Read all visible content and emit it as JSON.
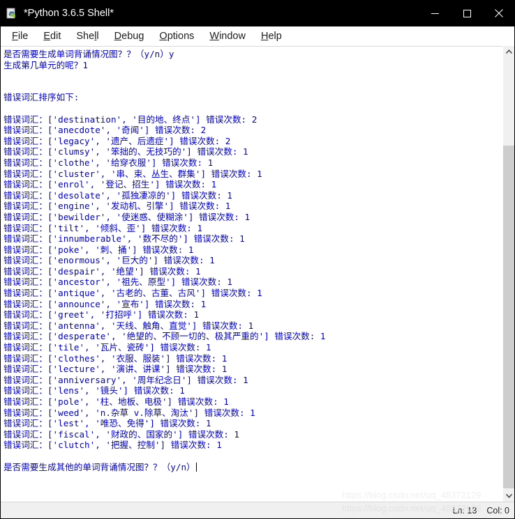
{
  "window": {
    "title": "*Python 3.6.5 Shell*",
    "icon": "python-idle-icon",
    "controls": {
      "minimize": "—",
      "maximize": "□",
      "close": "✕"
    },
    "colors": {
      "titlebar_bg": "#000000",
      "titlebar_fg": "#ffffff",
      "console_bg": "#ffffff",
      "console_fg": "#0000d0",
      "scrollbar_thumb": "#cdcdcd",
      "statusbar_bg": "#f0f0f0"
    }
  },
  "menubar": {
    "items": [
      {
        "label": "File",
        "mnemonic": "F"
      },
      {
        "label": "Edit",
        "mnemonic": "E"
      },
      {
        "label": "Shell",
        "mnemonic": "l"
      },
      {
        "label": "Debug",
        "mnemonic": "D"
      },
      {
        "label": "Options",
        "mnemonic": "O"
      },
      {
        "label": "Window",
        "mnemonic": "W"
      },
      {
        "label": "Help",
        "mnemonic": "H"
      }
    ]
  },
  "console": {
    "lines": [
      "是否需要生成单词背诵情况图？？（y/n）y",
      "生成第几单元的呢？1",
      "",
      "",
      "错误词汇排序如下:",
      "",
      "错误词汇：['destination', '目的地、终点'] 错误次数: 2",
      "错误词汇：['anecdote', '奇闻'] 错误次数: 2",
      "错误词汇：['legacy', '遗产、后遗症'] 错误次数: 2",
      "错误词汇：['clumsy', '笨拙的、无技巧的'] 错误次数: 1",
      "错误词汇：['clothe', '给穿衣服'] 错误次数: 1",
      "错误词汇：['cluster', '串、束、丛生、群集'] 错误次数: 1",
      "错误词汇：['enrol', '登记、招生'] 错误次数: 1",
      "错误词汇：['desolate', '孤独凄凉的'] 错误次数: 1",
      "错误词汇：['engine', '发动机、引擎'] 错误次数: 1",
      "错误词汇：['bewilder', '使迷惑、使糊涂'] 错误次数: 1",
      "错误词汇：['tilt', '倾斜、歪'] 错误次数: 1",
      "错误词汇：['innumberable', '数不尽的'] 错误次数: 1",
      "错误词汇：['poke', '刺、捅'] 错误次数: 1",
      "错误词汇：['enormous', '巨大的'] 错误次数: 1",
      "错误词汇：['despair', '绝望'] 错误次数: 1",
      "错误词汇：['ancestor', '祖先、原型'] 错误次数: 1",
      "错误词汇：['antique', '古老的、古董、古风'] 错误次数: 1",
      "错误词汇：['announce', '宣布'] 错误次数: 1",
      "错误词汇：['greet', '打招呼'] 错误次数: 1",
      "错误词汇：['antenna', '天线、触角、直觉'] 错误次数: 1",
      "错误词汇：['desperate', '绝望的、不顾一切的、极其严重的'] 错误次数: 1",
      "错误词汇：['tile', '瓦片、瓷砖'] 错误次数: 1",
      "错误词汇：['clothes', '衣服、服装'] 错误次数: 1",
      "错误词汇：['lecture', '演讲、讲课'] 错误次数: 1",
      "错误词汇：['anniversary', '周年纪念日'] 错误次数: 1",
      "错误词汇：['lens', '镜头'] 错误次数: 1",
      "错误词汇：['pole', '柱、地板、电极'] 错误次数: 1",
      "错误词汇：['weed', 'n.杂草 v.除草、淘汰'] 错误次数: 1",
      "错误词汇：['lest', '唯恐、免得'] 错误次数: 1",
      "错误词汇：['fiscal', '财政的、国家的'] 错误次数: 1",
      "错误词汇：['clutch', '把握、控制'] 错误次数: 1",
      "",
      "是否需要生成其他的单词背诵情况图？？（y/n）"
    ],
    "prompt_line_index": 38
  },
  "statusbar": {
    "line_label": "Ln: 13",
    "col_label": "Col: 0",
    "watermark": "https://blog.csdn.net/qq_48372129"
  }
}
